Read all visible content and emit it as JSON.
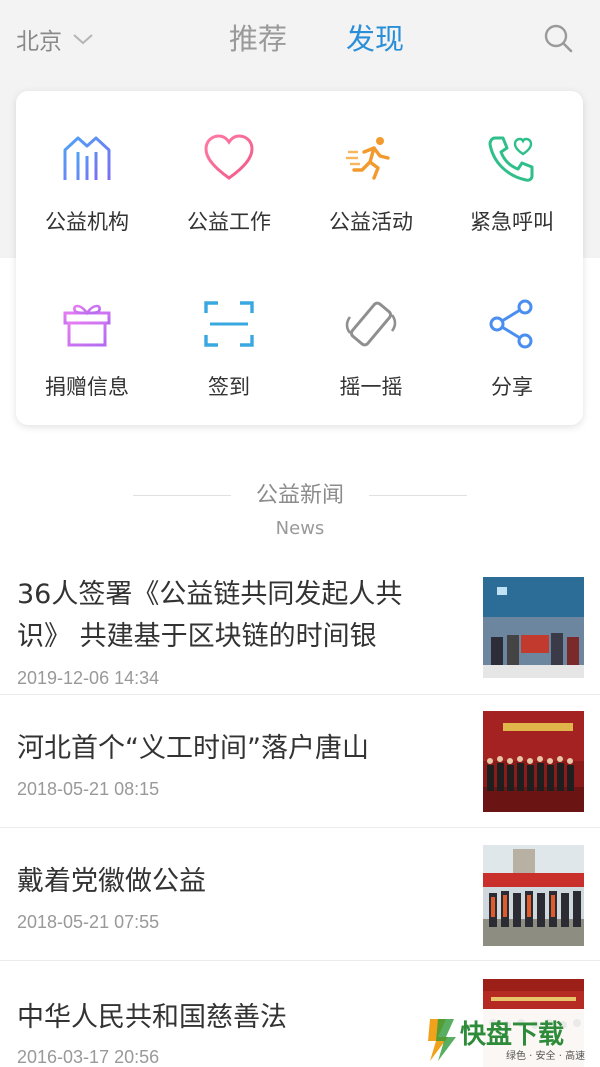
{
  "header": {
    "city": "北京",
    "tabs": [
      {
        "label": "推荐",
        "active": false
      },
      {
        "label": "发现",
        "active": true
      }
    ],
    "accent_color": "#2a8fd8"
  },
  "grid": [
    {
      "label": "公益机构",
      "icon": "building-icon"
    },
    {
      "label": "公益工作",
      "icon": "heart-icon"
    },
    {
      "label": "公益活动",
      "icon": "running-icon"
    },
    {
      "label": "紧急呼叫",
      "icon": "phone-heart-icon"
    },
    {
      "label": "捐赠信息",
      "icon": "gift-icon"
    },
    {
      "label": "签到",
      "icon": "scan-icon"
    },
    {
      "label": "摇一摇",
      "icon": "shake-icon"
    },
    {
      "label": "分享",
      "icon": "share-icon"
    }
  ],
  "section": {
    "title": "公益新闻",
    "subtitle": "News"
  },
  "news": [
    {
      "title": "36人签署《公益链共同发起人共识》 共建基于区块链的时间银",
      "time": "2019-12-06 14:34"
    },
    {
      "title": "河北首个“义工时间”落户唐山",
      "time": "2018-05-21 08:15"
    },
    {
      "title": "戴着党徽做公益",
      "time": "2018-05-21 07:55"
    },
    {
      "title": "中华人民共和国慈善法",
      "time": "2016-03-17 20:56"
    }
  ],
  "watermark": {
    "brand": "快盘下载",
    "slogan": "绿色 · 安全 · 高速"
  }
}
